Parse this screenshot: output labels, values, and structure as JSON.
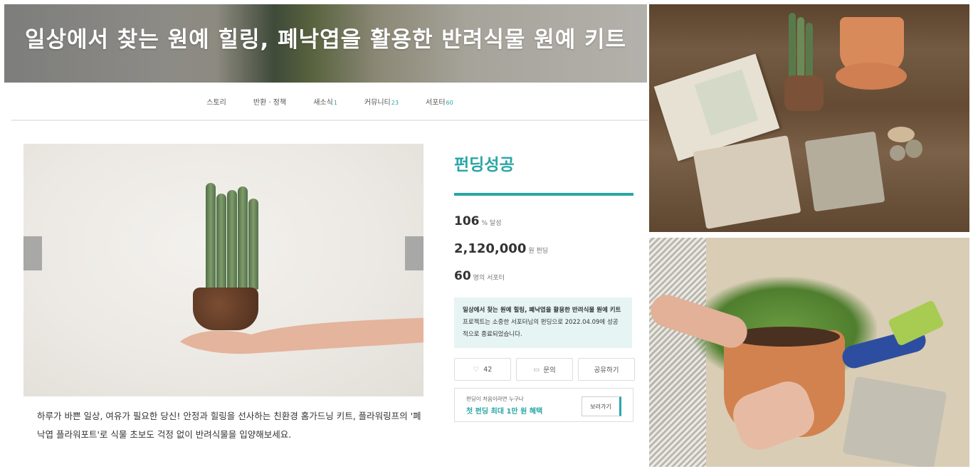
{
  "hero": {
    "title": "일상에서 찾는 원예 힐링, 폐낙엽을 활용한 반려식물 원예 키트"
  },
  "nav": [
    {
      "label": "스토리",
      "badge": ""
    },
    {
      "label": "반환 · 정책",
      "badge": ""
    },
    {
      "label": "새소식",
      "badge": "1"
    },
    {
      "label": "커뮤니티",
      "badge": "23"
    },
    {
      "label": "서포터",
      "badge": "60"
    }
  ],
  "main": {
    "description": "하루가 바쁜 일상, 여유가 필요한 당신! 안정과 힐링을 선사하는 친환경 홈가드닝 키트, 플라워링프의 '폐낙엽 플라워포트'로 식물 초보도 걱정 없이 반려식물을 입양해보세요."
  },
  "funding": {
    "status": "펀딩성공",
    "percent": "106",
    "percent_unit": "% 달성",
    "amount": "2,120,000",
    "amount_unit": "원 펀딩",
    "supporters": "60",
    "supporters_unit": "명의 서포터",
    "notice_bold": "일상에서 찾는 원예 힐링, 폐낙엽을 활용한 반려식물 원예 키트",
    "notice_rest": " 프로젝트는 소중한 서포터님의 펀딩으로 2022.04.09에 성공적으로 종료되었습니다.",
    "like_count": "42",
    "inquiry_label": "문의",
    "share_label": "공유하기",
    "promo_small": "펀딩이 처음이라면 누구나",
    "promo_main": "첫 펀딩 최대 1만 원 혜택",
    "promo_button": "보러가기"
  },
  "colors": {
    "accent": "#2aa6a6",
    "notice_bg": "#e6f4f4"
  }
}
